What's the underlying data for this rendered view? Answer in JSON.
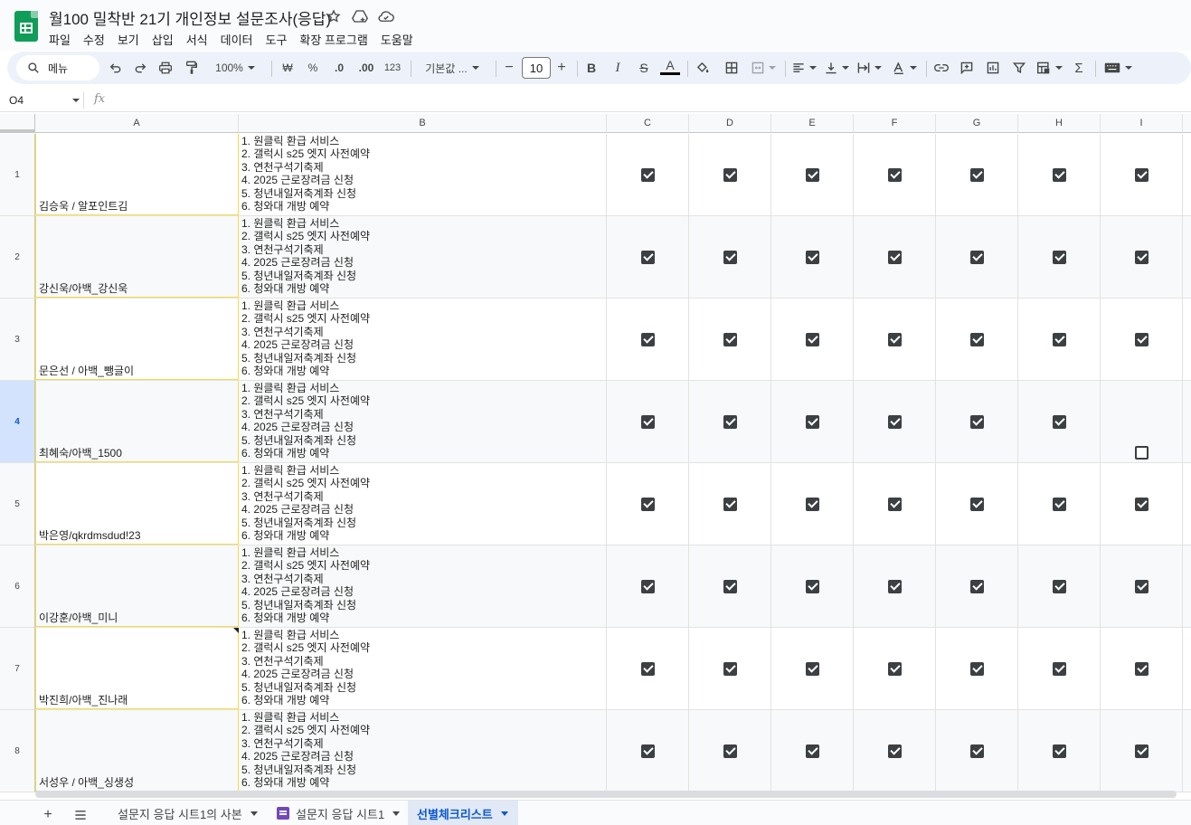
{
  "app": {
    "title": "월100 밀착반 21기 개인정보 설문조사(응답)",
    "menu": [
      "파일",
      "수정",
      "보기",
      "삽입",
      "서식",
      "데이터",
      "도구",
      "확장 프로그램",
      "도움말"
    ]
  },
  "toolbar": {
    "search_label": "메뉴",
    "zoom": "100%",
    "currency": "₩",
    "percent": "%",
    "decimal_decrease": ".0",
    "decimal_increase": ".00",
    "number_format": "123",
    "font": "기본값 ...",
    "font_size": "10",
    "minus": "−",
    "plus": "+",
    "bold": "B",
    "italic": "I",
    "strike": "S",
    "text_color": "A",
    "sum": "Σ"
  },
  "formula_bar": {
    "cell_ref": "O4",
    "fx": "fx"
  },
  "sheet": {
    "columns": [
      "A",
      "B",
      "C",
      "D",
      "E",
      "F",
      "G",
      "H",
      "I"
    ],
    "rows": [
      {
        "num": "1",
        "name": "김승욱 / 알포인트김",
        "checks": [
          true,
          true,
          true,
          true,
          true,
          true,
          true
        ]
      },
      {
        "num": "2",
        "name": "강신욱/아백_강신욱",
        "checks": [
          true,
          true,
          true,
          true,
          true,
          true,
          true
        ]
      },
      {
        "num": "3",
        "name": "문은선 / 아백_뺑글이",
        "checks": [
          true,
          true,
          true,
          true,
          true,
          true,
          true
        ]
      },
      {
        "num": "4",
        "name": "최혜숙/아백_1500",
        "checks": [
          true,
          true,
          true,
          true,
          true,
          true,
          false
        ]
      },
      {
        "num": "5",
        "name": "박은영/qkrdmsdud!23",
        "checks": [
          true,
          true,
          true,
          true,
          true,
          true,
          true
        ]
      },
      {
        "num": "6",
        "name": "이강훈/아백_미니",
        "checks": [
          true,
          true,
          true,
          true,
          true,
          true,
          true
        ]
      },
      {
        "num": "7",
        "name": "박진희/아백_진나래",
        "checks": [
          true,
          true,
          true,
          true,
          true,
          true,
          true
        ]
      },
      {
        "num": "8",
        "name": "서성우 / 아백_싱생성",
        "checks": [
          true,
          true,
          true,
          true,
          true,
          true,
          true
        ]
      }
    ],
    "checklist_items": [
      "1. 원클릭 환급 서비스",
      "2. 갤럭시 s25 엣지 사전예약",
      "3. 연천구석기축제",
      "4. 2025 근로장려금 신청",
      "5. 청년내일저축계좌 신청",
      "6. 청와대 개방 예약"
    ],
    "selected_row": "4"
  },
  "tabs": [
    {
      "label": "설문지 응답 시트1의 사본",
      "active": false
    },
    {
      "label": "설문지 응답 시트1",
      "active": false
    },
    {
      "label": "선별체크리스트",
      "active": true
    }
  ],
  "colors": {
    "accent": "#0b57d0",
    "sheets_green": "#0f9d58",
    "cell_border_highlight": "#f5dc45"
  }
}
